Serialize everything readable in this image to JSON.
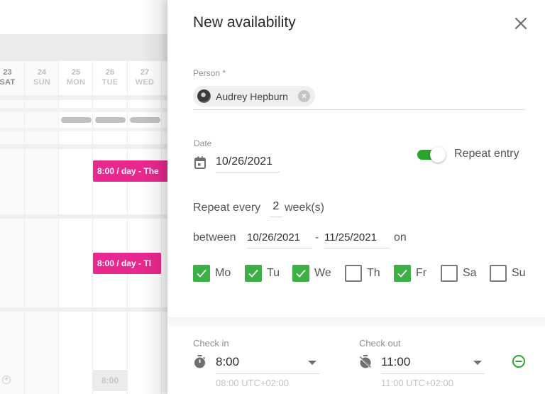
{
  "calendar": {
    "days": [
      {
        "num": "23",
        "name": "SAT",
        "dots": [
          "#9b5de5",
          "#2ccfc4",
          "#2ccfc4"
        ]
      },
      {
        "num": "24",
        "name": "SUN",
        "dots": [
          "#2ccfc4",
          "#2ccfc4"
        ]
      },
      {
        "num": "25",
        "name": "MON",
        "dots": []
      },
      {
        "num": "26",
        "name": "TUE",
        "dots": []
      },
      {
        "num": "27",
        "name": "WED",
        "dots": []
      }
    ],
    "events": [
      {
        "label": "8:00 / day - The",
        "color": "#e8288f"
      },
      {
        "label": "8:00 / day - Tl",
        "color": "#e8288f"
      }
    ],
    "ghost_time": "8:00",
    "add_icon": "plus-circle-icon"
  },
  "panel": {
    "title": "New availability",
    "close_icon": "close-icon",
    "person": {
      "label": "Person *",
      "chip_name": "Audrey Hepburn",
      "remove_icon": "remove-chip-icon"
    },
    "date": {
      "label": "Date",
      "icon": "calendar-icon",
      "value": "10/26/2021"
    },
    "repeat_toggle": {
      "label": "Repeat entry",
      "on": true,
      "color": "#2aa42a"
    },
    "repeat": {
      "prefix": "Repeat every",
      "interval": "2",
      "suffix": "week(s)",
      "between_label": "between",
      "start": "10/26/2021",
      "dash": "-",
      "end": "11/25/2021",
      "on_label": "on"
    },
    "weekdays": [
      {
        "label": "Mo",
        "checked": true
      },
      {
        "label": "Tu",
        "checked": true
      },
      {
        "label": "We",
        "checked": true
      },
      {
        "label": "Th",
        "checked": false
      },
      {
        "label": "Fr",
        "checked": true
      },
      {
        "label": "Sa",
        "checked": false
      },
      {
        "label": "Su",
        "checked": false
      }
    ],
    "check_color": "#3cb044",
    "check_in": {
      "label": "Check in",
      "icon": "stopwatch-icon",
      "value": "8:00",
      "helper": "08:00 UTC+02:00"
    },
    "check_out": {
      "label": "Check out",
      "icon": "stopwatch-off-icon",
      "value": "11:00",
      "helper": "11:00 UTC+02:00"
    },
    "remove_row_icon": "minus-circle-icon"
  }
}
